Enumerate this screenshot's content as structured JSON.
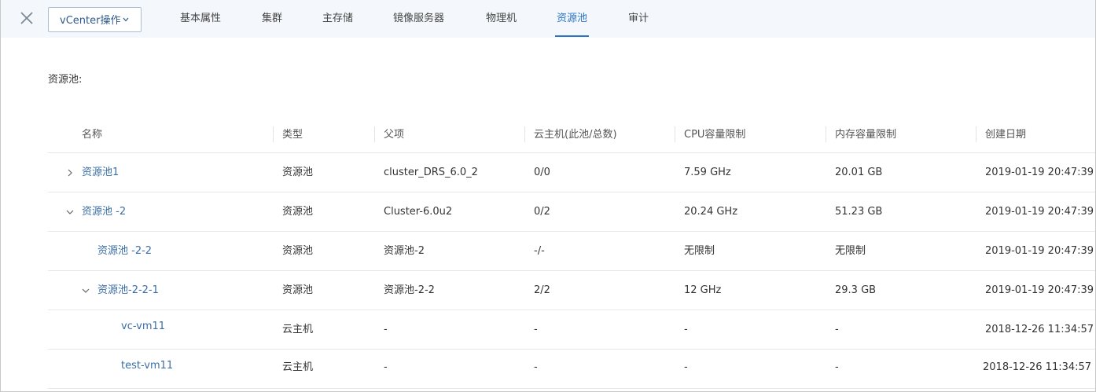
{
  "topbar": {
    "close_icon": "close-icon",
    "ops_label": "vCenter操作",
    "ops_caret_icon": "chevron-down-icon",
    "tabs": [
      {
        "label": "基本属性"
      },
      {
        "label": "集群"
      },
      {
        "label": "主存储"
      },
      {
        "label": "镜像服务器"
      },
      {
        "label": "物理机"
      },
      {
        "label": "资源池",
        "active": true
      },
      {
        "label": "审计"
      }
    ]
  },
  "section": {
    "label": "资源池:"
  },
  "table": {
    "headers": [
      "名称",
      "类型",
      "父项",
      "云主机(此池/总数)",
      "CPU容量限制",
      "内存容量限制",
      "创建日期"
    ],
    "rows": [
      {
        "name": "资源池1",
        "type": "资源池",
        "parent": "cluster_DRS_6.0_2",
        "vms": "0/0",
        "cpu": "7.59 GHz",
        "mem": "20.01 GB",
        "created": "2019-01-19 20:47:39",
        "toggle": "chevron-right-icon"
      },
      {
        "name": "资源池 -2",
        "type": "资源池",
        "parent": "Cluster-6.0u2",
        "vms": "0/2",
        "cpu": "20.24 GHz",
        "mem": "51.23 GB",
        "created": "2019-01-19 20:47:39",
        "toggle": "chevron-down-icon"
      },
      {
        "name": "资源池 -2-2",
        "type": "资源池",
        "parent": "资源池-2",
        "vms": "-/-",
        "cpu": "无限制",
        "mem": "无限制",
        "created": "2019-01-19 20:47:39",
        "toggle": ""
      },
      {
        "name": "资源池-2-2-1",
        "type": "资源池",
        "parent": "资源池-2-2",
        "vms": "2/2",
        "cpu": "12 GHz",
        "mem": "29.3 GB",
        "created": "2019-01-19 20:47:39",
        "toggle": "chevron-down-icon"
      },
      {
        "name": "vc-vm11",
        "type": "云主机",
        "parent": "-",
        "vms": "-",
        "cpu": "-",
        "mem": "-",
        "created": "2018-12-26 11:34:57",
        "toggle": ""
      },
      {
        "name": "test-vm11",
        "type": "云主机",
        "parent": "-",
        "vms": "-",
        "cpu": "-",
        "mem": "-",
        "created": "2018-12-26 11:34:57",
        "toggle": ""
      }
    ]
  },
  "colors": {
    "accent": "#2a73c4",
    "link": "#3a6ea5",
    "topbar_bg": "#f4f8fc"
  }
}
